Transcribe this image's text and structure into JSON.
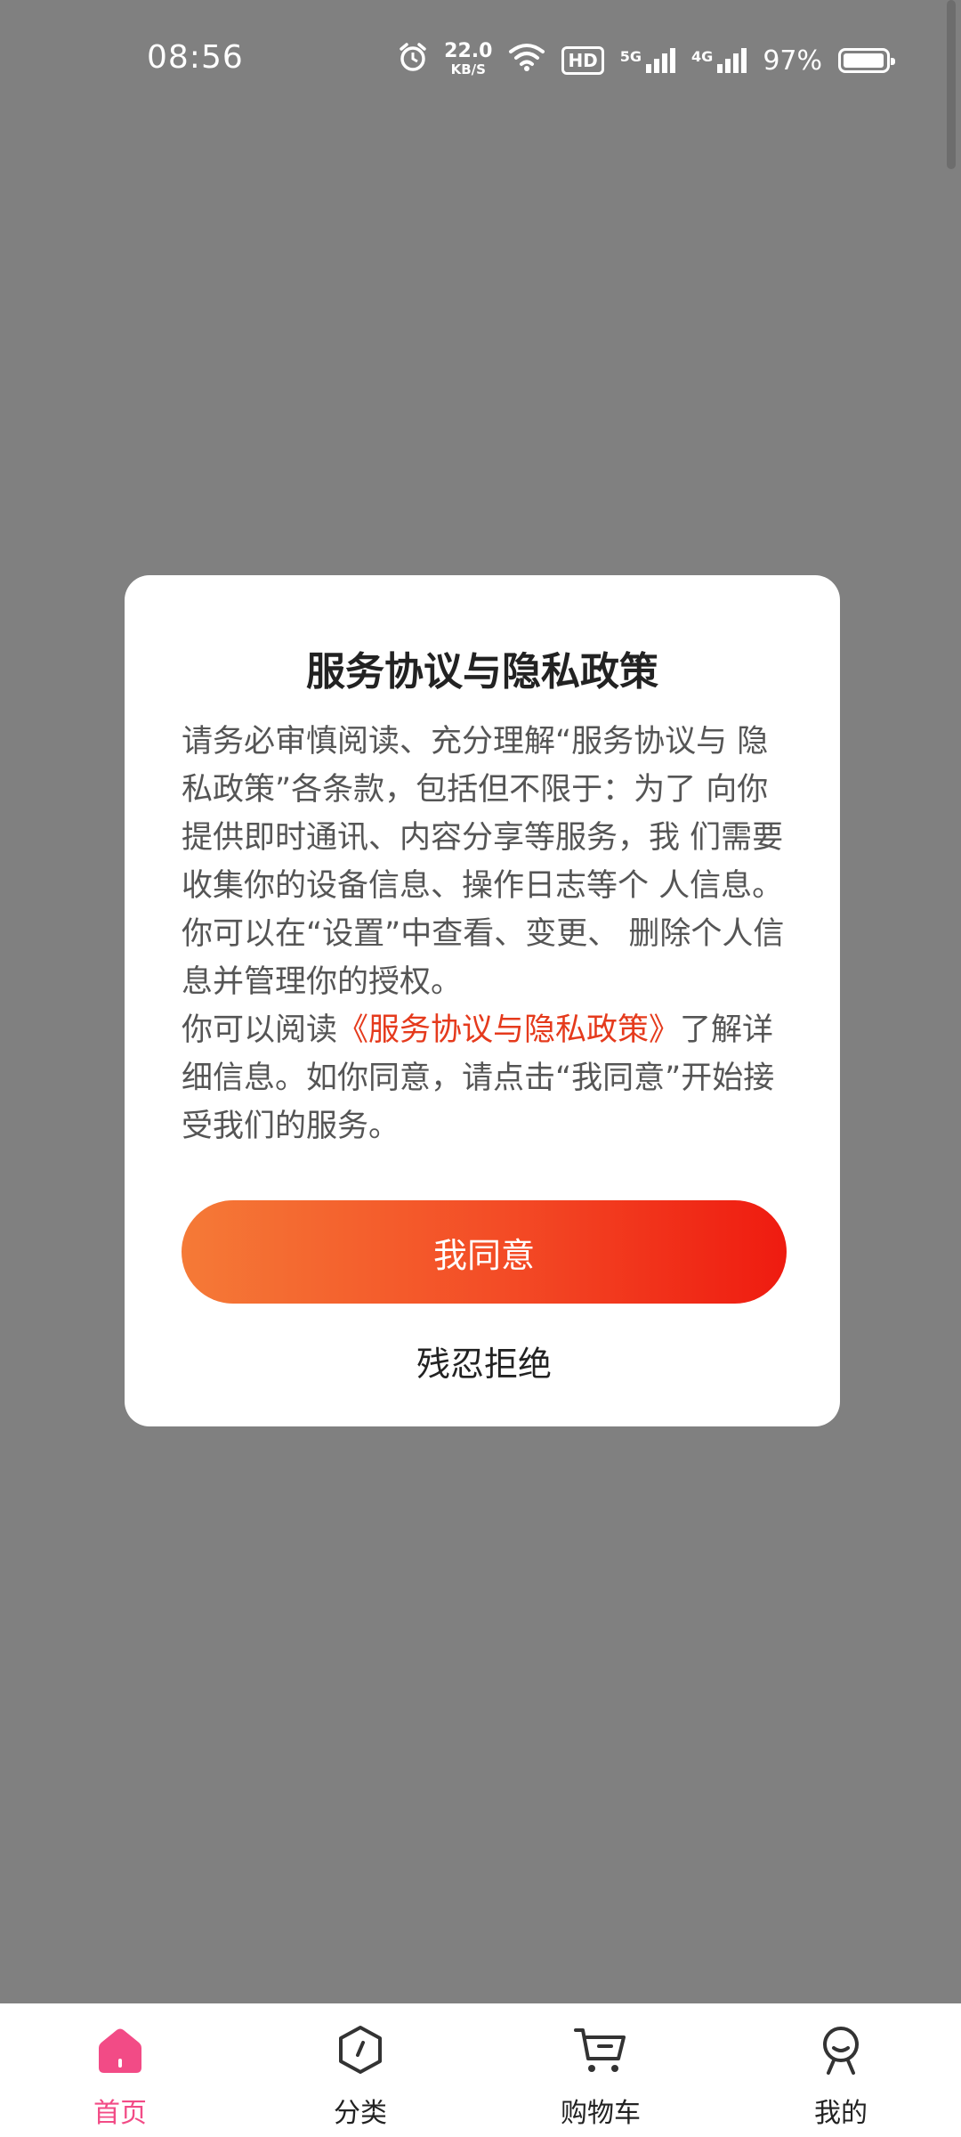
{
  "status_bar": {
    "time": "08:56",
    "net_speed_value": "22.0",
    "net_speed_unit": "KB/S",
    "hd_label": "HD",
    "sim1_label": "5G",
    "sim2_label": "4G",
    "battery_percent": "97%",
    "battery_level": 0.97,
    "icons": [
      "alarm-icon",
      "wifi-icon",
      "signal-icon",
      "battery-icon"
    ]
  },
  "dialog": {
    "title": "服务协议与隐私政策",
    "paragraph1": "请务必审慎阅读、充分理解“服务协议与 隐私政策”各条款，包括但不限于：为了 向你提供即时通讯、内容分享等服务，我 们需要收集你的设备信息、操作日志等个 人信息。你可以在“设置”中查看、变更、 删除个人信息并管理你的授权。",
    "paragraph2_prefix": "你可以阅读",
    "policy_link": "《服务协议与隐私政策》",
    "paragraph2_suffix": "了解详细信息。如你同意，请点击“我同意”开始接受我们的服务。",
    "agree_label": "我同意",
    "reject_label": "残忍拒绝"
  },
  "bottom_nav": {
    "items": [
      {
        "label": "首页",
        "icon": "home-icon",
        "active": true
      },
      {
        "label": "分类",
        "icon": "category-icon",
        "active": false
      },
      {
        "label": "购物车",
        "icon": "cart-icon",
        "active": false
      },
      {
        "label": "我的",
        "icon": "profile-icon",
        "active": false
      }
    ]
  },
  "colors": {
    "overlay": "#808080",
    "accent_pink": "#f24b86",
    "link_red": "#e53a1c",
    "button_gradient_start": "#f57a37",
    "button_gradient_end": "#ef1b10"
  }
}
